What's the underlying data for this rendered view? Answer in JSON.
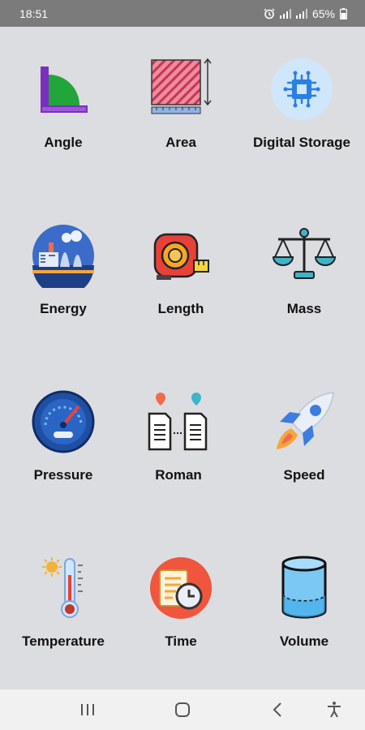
{
  "status_bar": {
    "time": "18:51",
    "battery": "65%"
  },
  "categories": [
    {
      "label": "Angle",
      "icon": "angle-icon"
    },
    {
      "label": "Area",
      "icon": "area-icon"
    },
    {
      "label": "Digital Storage",
      "icon": "digital-storage-icon"
    },
    {
      "label": "Energy",
      "icon": "energy-icon"
    },
    {
      "label": "Length",
      "icon": "tape-measure-icon"
    },
    {
      "label": "Mass",
      "icon": "scale-icon"
    },
    {
      "label": "Pressure",
      "icon": "pressure-gauge-icon"
    },
    {
      "label": "Roman",
      "icon": "roman-documents-icon"
    },
    {
      "label": "Speed",
      "icon": "rocket-icon"
    },
    {
      "label": "Temperature",
      "icon": "thermometer-icon"
    },
    {
      "label": "Time",
      "icon": "time-icon"
    },
    {
      "label": "Volume",
      "icon": "cylinder-icon"
    }
  ],
  "colors": {
    "background": "#dcdde1",
    "status_bar": "#7b7b7b",
    "nav_bar": "#f1f1f1"
  }
}
